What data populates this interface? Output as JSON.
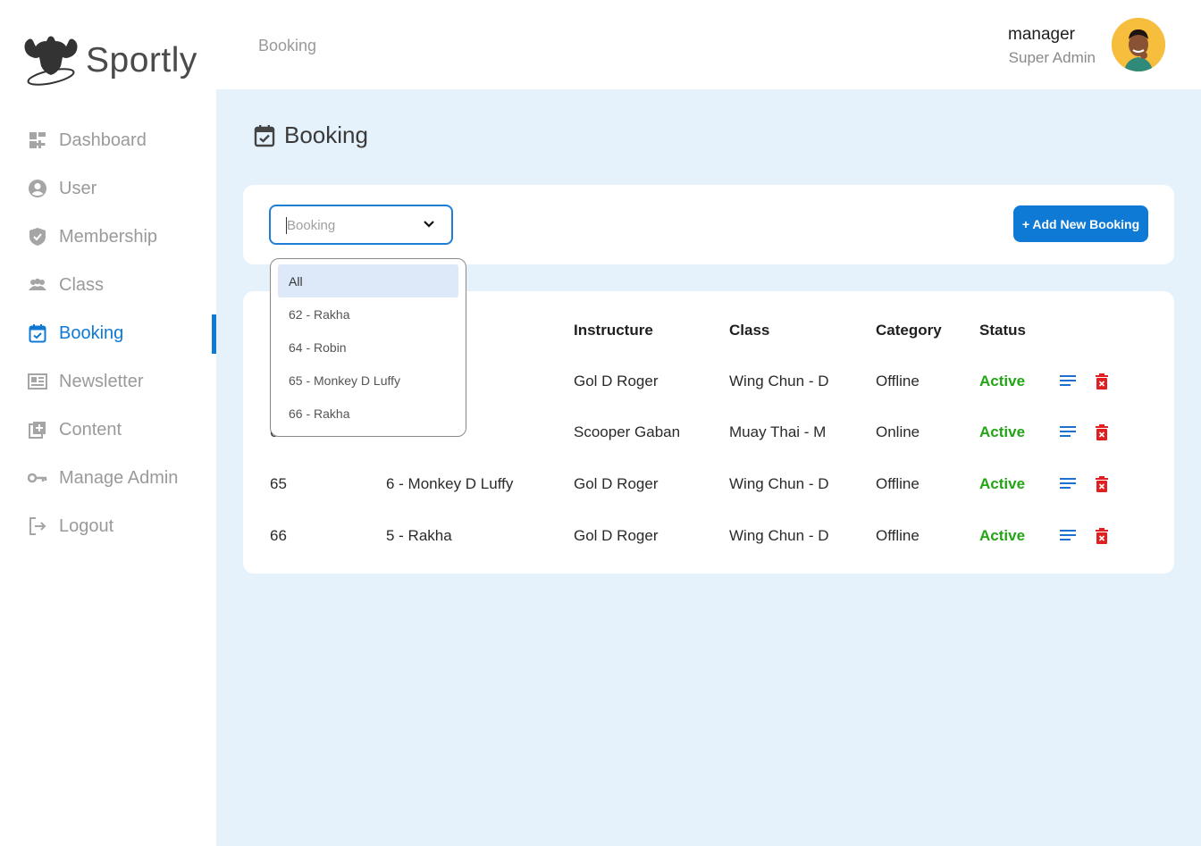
{
  "app": {
    "name": "Sportly"
  },
  "sidebar": {
    "items": [
      {
        "label": "Dashboard",
        "icon": "dashboard-icon",
        "active": false
      },
      {
        "label": "User",
        "icon": "user-icon",
        "active": false
      },
      {
        "label": "Membership",
        "icon": "shield-check-icon",
        "active": false
      },
      {
        "label": "Class",
        "icon": "group-icon",
        "active": false
      },
      {
        "label": "Booking",
        "icon": "calendar-check-icon",
        "active": true
      },
      {
        "label": "Newsletter",
        "icon": "newspaper-icon",
        "active": false
      },
      {
        "label": "Content",
        "icon": "add-content-icon",
        "active": false
      },
      {
        "label": "Manage Admin",
        "icon": "key-icon",
        "active": false
      },
      {
        "label": "Logout",
        "icon": "logout-icon",
        "active": false
      }
    ]
  },
  "header": {
    "breadcrumb": "Booking",
    "user": {
      "name": "manager",
      "role": "Super Admin"
    }
  },
  "page": {
    "title": "Booking"
  },
  "filter": {
    "placeholder": "Booking",
    "add_button": "+ Add New Booking",
    "options": [
      "All",
      "62 - Rakha",
      "64 - Robin",
      "65 - Monkey D Luffy",
      "66 - Rakha"
    ],
    "highlighted": "All"
  },
  "table": {
    "columns": [
      "Instructure",
      "Class",
      "Category",
      "Status"
    ],
    "rows": [
      {
        "id": "",
        "member": "",
        "instructure": "Gol D Roger",
        "class": "Wing Chun - D",
        "category": "Offline",
        "status": "Active"
      },
      {
        "id": "6",
        "member": "",
        "instructure": "Scooper Gaban",
        "class": "Muay Thai - M",
        "category": "Online",
        "status": "Active"
      },
      {
        "id": "65",
        "member": "6 - Monkey D Luffy",
        "instructure": "Gol D Roger",
        "class": "Wing Chun - D",
        "category": "Offline",
        "status": "Active"
      },
      {
        "id": "66",
        "member": "5 - Rakha",
        "instructure": "Gol D Roger",
        "class": "Wing Chun - D",
        "category": "Offline",
        "status": "Active"
      }
    ]
  },
  "colors": {
    "accent": "#1079d4",
    "status_active": "#22a514",
    "delete": "#e02020",
    "main_bg": "#e6f2fb"
  }
}
